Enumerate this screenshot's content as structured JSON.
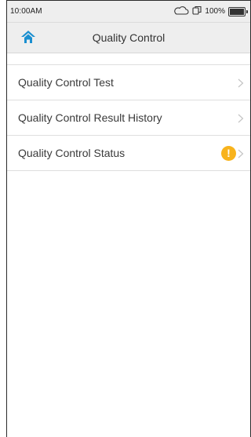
{
  "status_bar": {
    "time": "10:00AM",
    "battery_text": "100%",
    "battery_level": 1.0
  },
  "header": {
    "title": "Quality Control",
    "home_icon": "home-icon",
    "accent_color": "#1a8fd0"
  },
  "menu": {
    "items": [
      {
        "label": "Quality Control Test",
        "icon": "chevron-right-icon"
      },
      {
        "label": "Quality Control Result History",
        "icon": "chevron-right-icon"
      },
      {
        "label": "Quality Control Status",
        "icon": "chevron-right-icon",
        "badge_icon": "warning-icon",
        "badge_text": "!",
        "badge_color": "#f8b31c"
      }
    ]
  }
}
